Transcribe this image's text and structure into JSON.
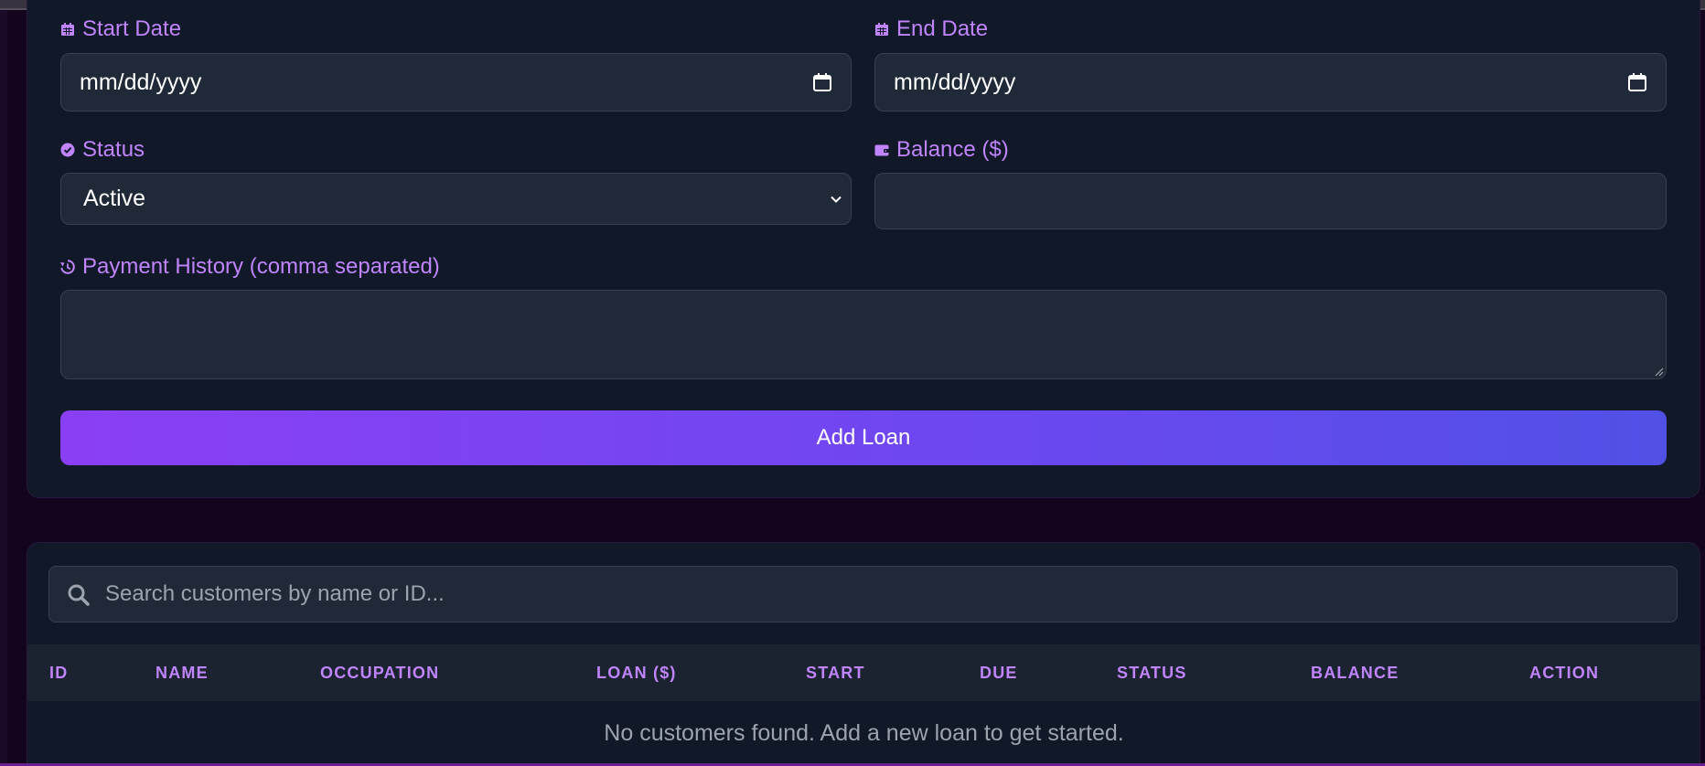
{
  "form": {
    "start_date": {
      "label": "Start Date",
      "value": "mm/dd/yyyy",
      "icon": "calendar-icon"
    },
    "end_date": {
      "label": "End Date",
      "value": "mm/dd/yyyy",
      "icon": "calendar-icon"
    },
    "status": {
      "label": "Status",
      "selected": "Active",
      "icon": "check-circle-icon"
    },
    "balance": {
      "label": "Balance ($)",
      "value": "",
      "icon": "wallet-icon"
    },
    "payment_history": {
      "label": "Payment History (comma separated)",
      "value": "",
      "icon": "history-icon"
    },
    "submit_label": "Add Loan"
  },
  "search": {
    "placeholder": "Search customers by name or ID...",
    "icon": "search-icon"
  },
  "table": {
    "columns": [
      "ID",
      "NAME",
      "OCCUPATION",
      "LOAN ($)",
      "START",
      "DUE",
      "STATUS",
      "BALANCE",
      "ACTION"
    ],
    "empty_message": "No customers found. Add a new loan to get started."
  },
  "colors": {
    "accent": "#c084fc",
    "button_gradient_start": "#8b3ff5",
    "button_gradient_end": "#5150e5",
    "card_bg": "#111827",
    "input_bg": "#1f2937"
  }
}
